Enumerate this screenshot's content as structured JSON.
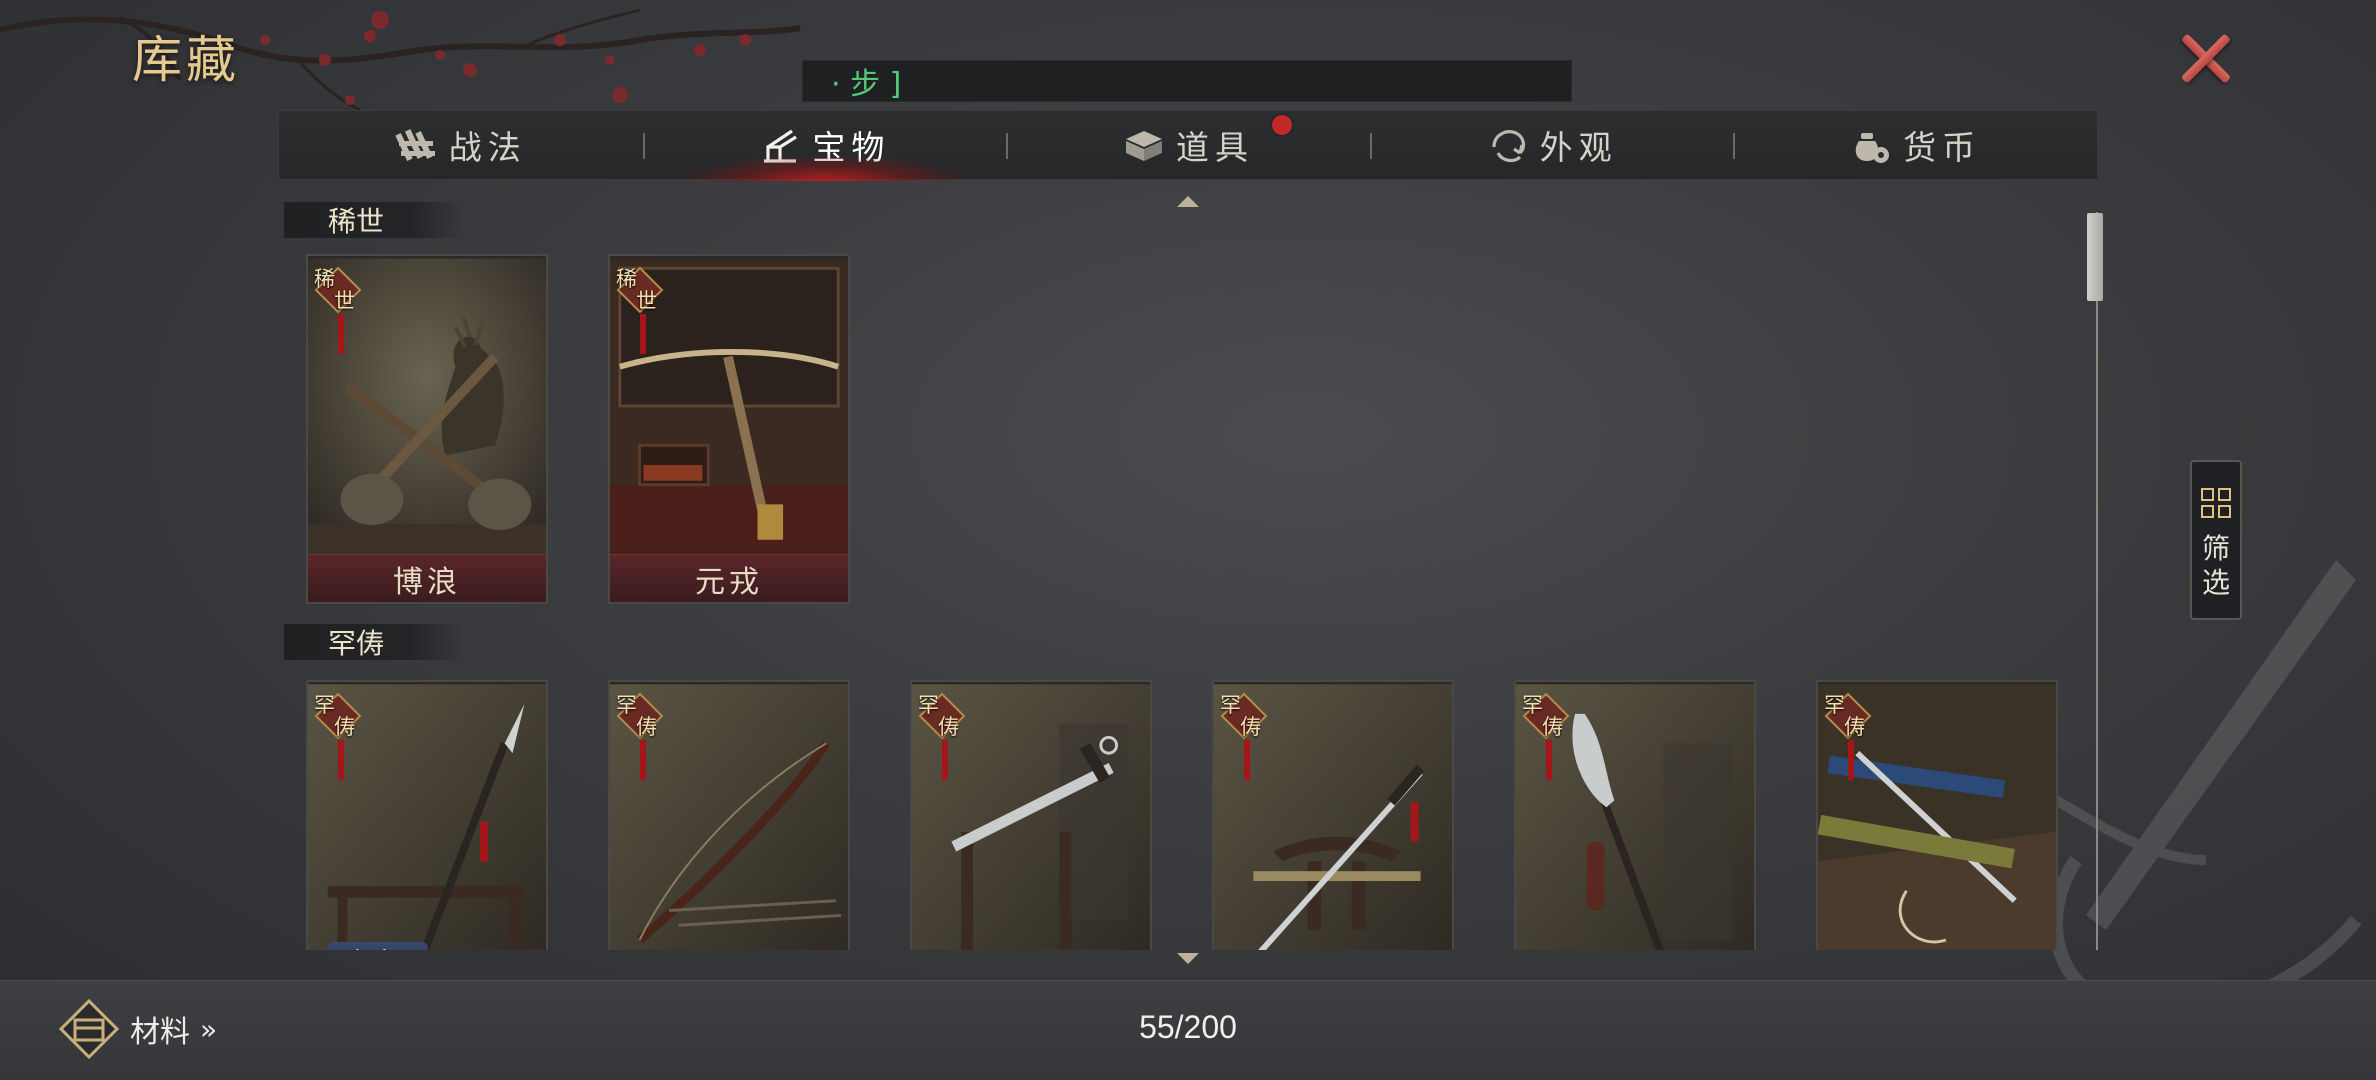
{
  "header": {
    "title": "库藏",
    "top_bar_text": "· 步 ]",
    "close_label": "×"
  },
  "tabs": [
    {
      "label": "战法",
      "icon": "tactics-icon",
      "active": false,
      "badge": false
    },
    {
      "label": "宝物",
      "icon": "treasure-icon",
      "active": true,
      "badge": false
    },
    {
      "label": "道具",
      "icon": "items-icon",
      "active": false,
      "badge": true
    },
    {
      "label": "外观",
      "icon": "appearance-icon",
      "active": false,
      "badge": false
    },
    {
      "label": "货币",
      "icon": "currency-icon",
      "active": false,
      "badge": false
    }
  ],
  "sections": [
    {
      "header": "稀世",
      "items": [
        {
          "name": "博浪",
          "rarity": "稀世",
          "art": "crossed-maces-and-deer"
        },
        {
          "name": "元戎",
          "rarity": "稀世",
          "art": "crossbow-on-stand"
        }
      ]
    },
    {
      "header": "罕俦",
      "items": [
        {
          "name": "",
          "rarity": "罕俦",
          "art": "spear",
          "partial_label": "陷阵"
        },
        {
          "name": "",
          "rarity": "罕俦",
          "art": "bow"
        },
        {
          "name": "",
          "rarity": "罕俦",
          "art": "sword-on-rack"
        },
        {
          "name": "",
          "rarity": "罕俦",
          "art": "sword-on-stand"
        },
        {
          "name": "",
          "rarity": "罕俦",
          "art": "glaive"
        },
        {
          "name": "",
          "rarity": "罕俦",
          "art": "sheathed-sword"
        }
      ]
    }
  ],
  "filter": {
    "label_line1": "筛",
    "label_line2": "选",
    "icon": "grid-icon"
  },
  "footer": {
    "materials_label": "材料",
    "materials_chevron": "»",
    "capacity": "55/200"
  },
  "colors": {
    "accent_gold": "#e6c98e",
    "active_tab_glow": "#be1e1e",
    "badge_red": "#c0282a",
    "close_red": "#c8534c",
    "text_green": "#58c878"
  }
}
